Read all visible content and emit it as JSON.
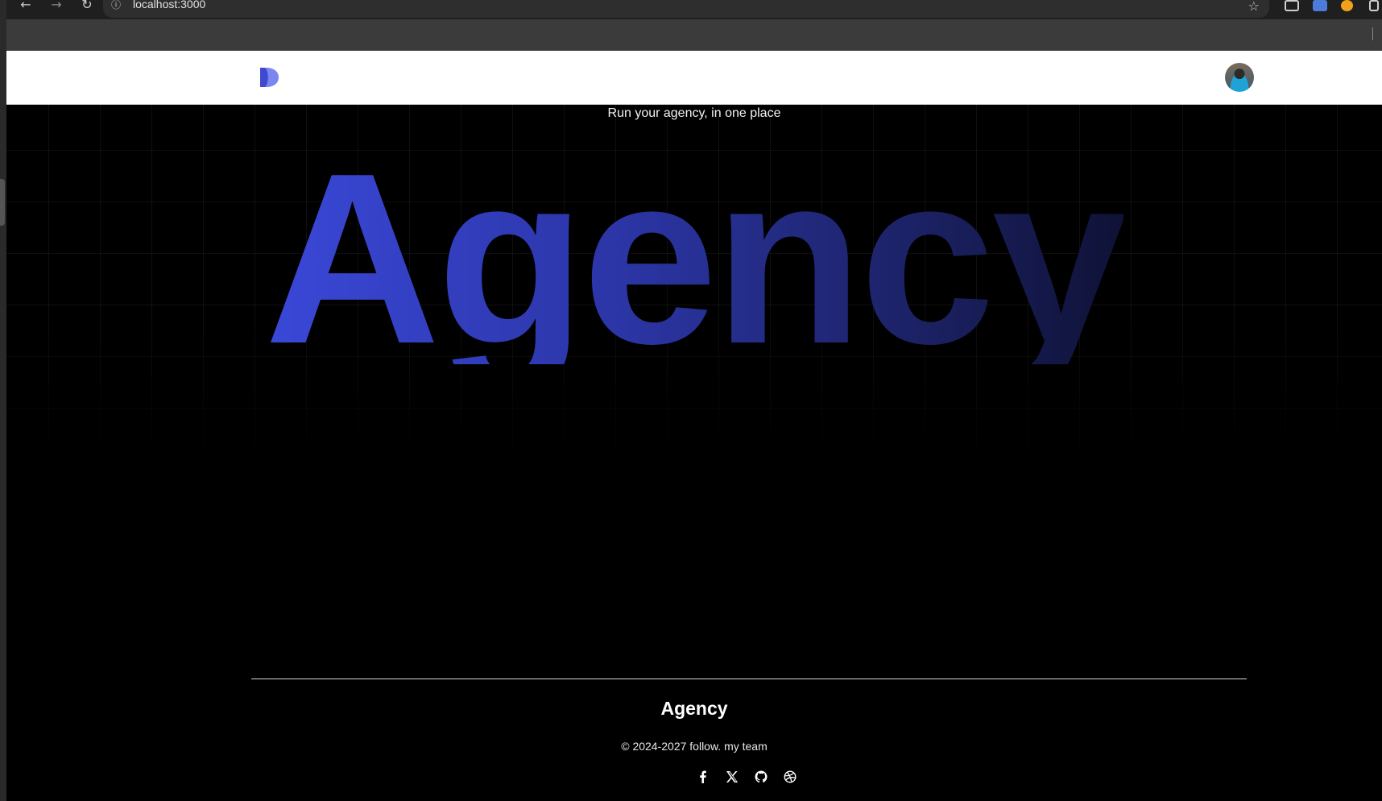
{
  "browser": {
    "url": "localhost:3000",
    "back_glyph": "←",
    "forward_glyph": "→",
    "reload_glyph": "↻",
    "info_glyph": "ⓘ",
    "star_glyph": "☆"
  },
  "header": {
    "logo_icon": "logo-icon",
    "avatar_icon": "user-avatar"
  },
  "hero": {
    "tagline": "Run your agency, in one place",
    "headline": "Agency"
  },
  "footer": {
    "title": "Agency",
    "copyright": "© 2024-2027 follow. my team",
    "socials": [
      "facebook-icon",
      "x-icon",
      "github-icon",
      "dribbble-icon"
    ]
  },
  "colors": {
    "accent": "#3a48d8",
    "background": "#000000",
    "header_bg": "#ffffff"
  }
}
